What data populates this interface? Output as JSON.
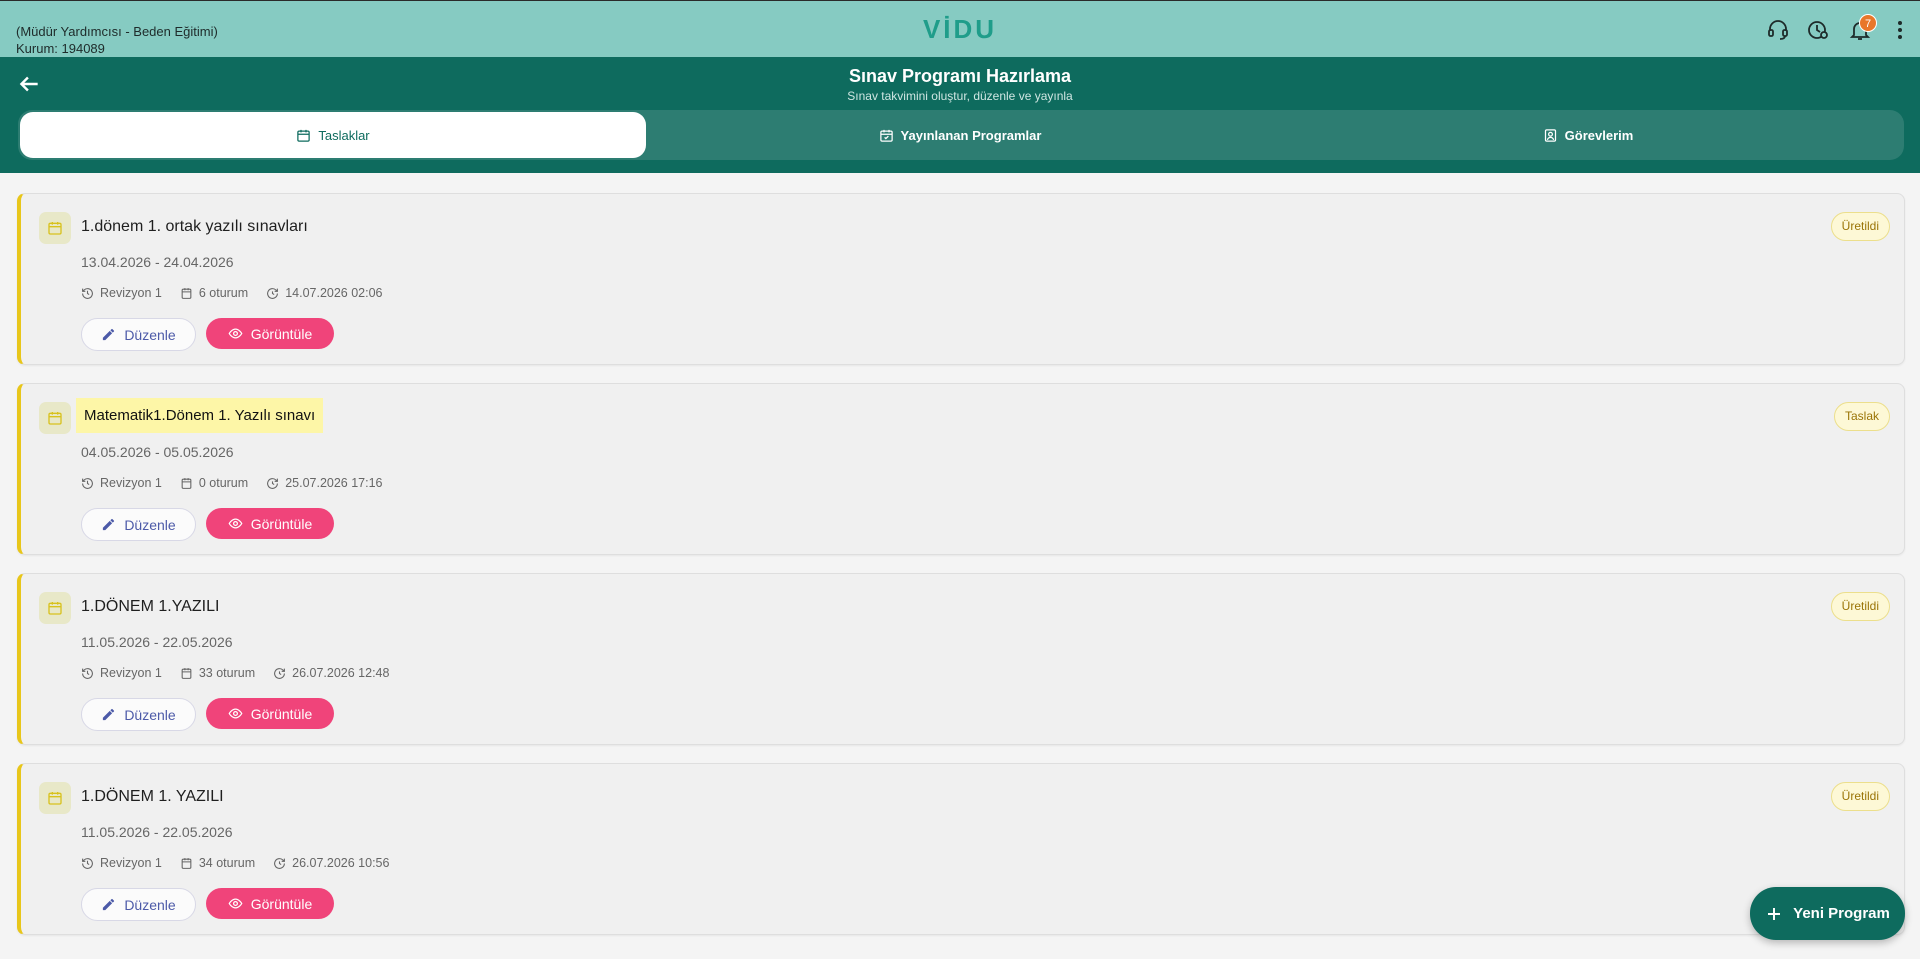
{
  "topbar": {
    "user_role": "(Müdür Yardımcısı - Beden Eğitimi)",
    "institution": "Kurum: 194089",
    "logo": "VİDU",
    "notification_count": "7",
    "icons": [
      "support-agent-icon",
      "clock-settings-icon",
      "bell-icon",
      "more-vert-icon"
    ]
  },
  "header": {
    "title": "Sınav Programı Hazırlama",
    "subtitle": "Sınav takvimini oluştur, düzenle ve yayınla",
    "tabs": [
      {
        "label": "Taslaklar",
        "active": true
      },
      {
        "label": "Yayınlanan Programlar",
        "active": false
      },
      {
        "label": "Görevlerim",
        "active": false
      }
    ]
  },
  "cards": [
    {
      "title": "1.dönem 1. ortak yazılı sınavları",
      "dates": "13.04.2026 - 24.04.2026",
      "revision": "Revizyon 1",
      "sessions": "6 oturum",
      "updated": "14.07.2026 02:06",
      "status": "Üretildi"
    },
    {
      "title": "Matematik1.Dönem 1. Yazılı sınavı",
      "dates": "04.05.2026 - 05.05.2026",
      "revision": "Revizyon 1",
      "sessions": "0 oturum",
      "updated": "25.07.2026 17:16",
      "status": "Taslak"
    },
    {
      "title": "1.DÖNEM 1.YAZILI",
      "dates": "11.05.2026 - 22.05.2026",
      "revision": "Revizyon 1",
      "sessions": "33 oturum",
      "updated": "26.07.2026 12:48",
      "status": "Üretildi"
    },
    {
      "title": "1.DÖNEM 1. YAZILI",
      "dates": "11.05.2026 - 22.05.2026",
      "revision": "Revizyon 1",
      "sessions": "34 oturum",
      "updated": "26.07.2026 10:56",
      "status": "Üretildi"
    }
  ],
  "actions": {
    "edit_label": "Düzenle",
    "view_label": "Görüntüle",
    "new_program_label": "Yeni Program"
  },
  "colors": {
    "topbar": "#86cbc2",
    "header": "#0e6b5e",
    "accent_pink": "#f0447a",
    "card_border_accent": "#e8c61a",
    "badge": "#e8772a"
  }
}
